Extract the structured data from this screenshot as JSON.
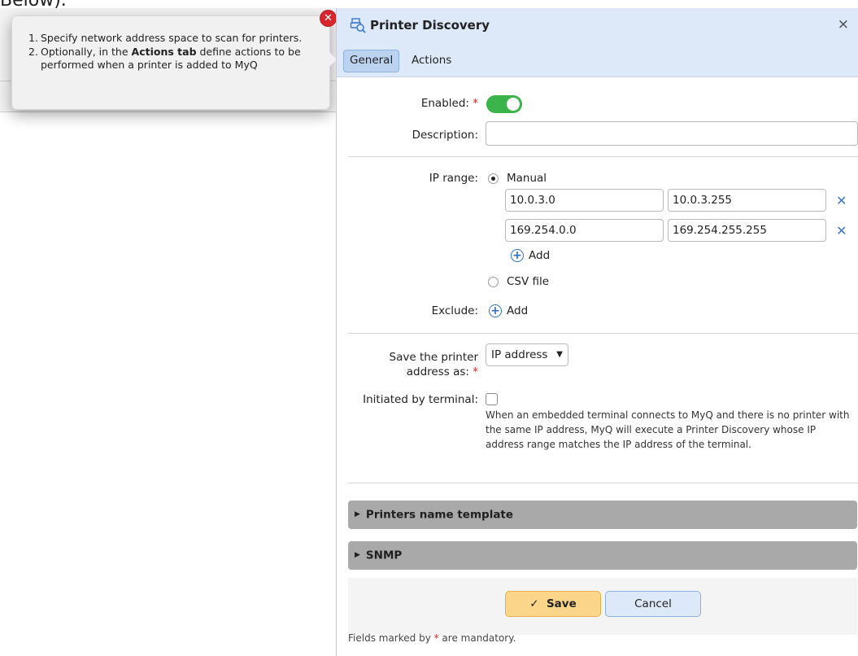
{
  "background": {
    "caption": "Below)."
  },
  "tooltip": {
    "item1_num": "1.",
    "item1": "Specify network address space to scan for printers.",
    "item2_num": "2.",
    "item2_pre": "Optionally, in the ",
    "item2_bold": "Actions tab",
    "item2_post": " define actions to be performed when a printer is added to MyQ",
    "close": "✕"
  },
  "dialog": {
    "title": "Printer Discovery",
    "close": "×",
    "tabs": [
      "General",
      "Actions"
    ]
  },
  "form": {
    "enabled_label": "Enabled:",
    "enabled_value": true,
    "description_label": "Description:",
    "description_value": "",
    "ip_range_label": "IP range:",
    "ip_mode_manual": "Manual",
    "ip_mode_csv": "CSV file",
    "ranges": [
      {
        "from": "10.0.3.0",
        "to": "10.0.3.255"
      },
      {
        "from": "169.254.0.0",
        "to": "169.254.255.255"
      }
    ],
    "add_label": "Add",
    "exclude_label": "Exclude:",
    "exclude_add": "Add",
    "save_as_label_1": "Save the printer",
    "save_as_label_2": "address as:",
    "save_as_value": "IP address",
    "terminal_label": "Initiated by terminal:",
    "terminal_help": "When an embedded terminal connects to MyQ and there is no printer with the same IP address, MyQ will execute a Printer Discovery whose IP address range matches the IP address of the terminal.",
    "required_mark": "*"
  },
  "sections": [
    "Printers name template",
    "SNMP"
  ],
  "footer": {
    "save": "Save",
    "cancel": "Cancel",
    "note_pre": "Fields marked by ",
    "note_post": " are mandatory."
  },
  "colors": {
    "accent": "#3a78c9",
    "toggle_on": "#3bb54a",
    "save_button": "#fbd68a",
    "required": "#d02a2a"
  }
}
